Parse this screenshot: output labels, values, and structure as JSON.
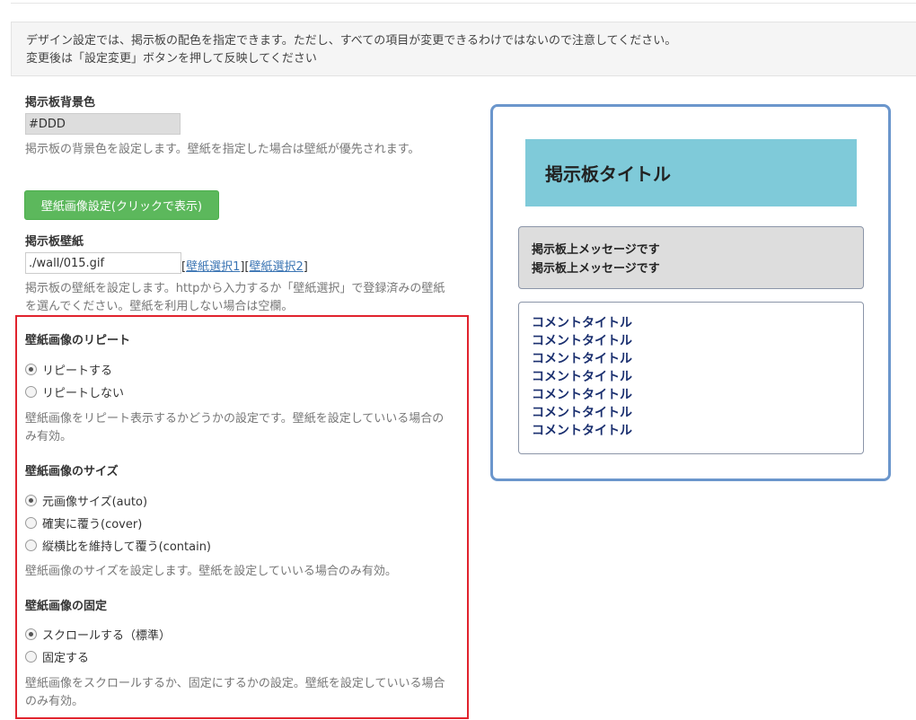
{
  "notice": {
    "line1": "デザイン設定では、掲示板の配色を指定できます。ただし、すべての項目が変更できるわけではないので注意してください。",
    "line2": "変更後は「設定変更」ボタンを押して反映してください"
  },
  "bg_color": {
    "label": "掲示板背景色",
    "value": "#DDD",
    "help": "掲示板の背景色を設定します。壁紙を指定した場合は壁紙が優先されます。"
  },
  "wallpaper_button": {
    "label": "壁紙画像設定(クリックで表示)",
    "color": "#5cb85c"
  },
  "wallpaper": {
    "label": "掲示板壁紙",
    "value": "./wall/015.gif",
    "link1": "壁紙選択1",
    "link2": "壁紙選択2",
    "help": "掲示板の壁紙を設定します。httpから入力するか「壁紙選択」で登録済みの壁紙を選んでください。壁紙を利用しない場合は空欄。"
  },
  "repeat": {
    "title": "壁紙画像のリピート",
    "options": [
      "リピートする",
      "リピートしない"
    ],
    "selected": 0,
    "help": "壁紙画像をリピート表示するかどうかの設定です。壁紙を設定していいる場合のみ有効。"
  },
  "size": {
    "title": "壁紙画像のサイズ",
    "options": [
      "元画像サイズ(auto)",
      "確実に覆う(cover)",
      "縦横比を維持して覆う(contain)"
    ],
    "selected": 0,
    "help": "壁紙画像のサイズを設定します。壁紙を設定していいる場合のみ有効。"
  },
  "fixed": {
    "title": "壁紙画像の固定",
    "options": [
      "スクロールする（標準）",
      "固定する"
    ],
    "selected": 0,
    "help": "壁紙画像をスクロールするか、固定にするかの設定。壁紙を設定していいる場合のみ有効。"
  },
  "preview": {
    "title": "掲示板タイトル",
    "messages": [
      "掲示板上メッセージです",
      "掲示板上メッセージです"
    ],
    "comments": [
      "コメントタイトル",
      "コメントタイトル",
      "コメントタイトル",
      "コメントタイトル",
      "コメントタイトル",
      "コメントタイトル",
      "コメントタイトル"
    ],
    "colors": {
      "frame": "#6b96cc",
      "title_bg": "#7fcad9",
      "message_bg": "#dddddd",
      "wall_bg": "#fdd3b3",
      "highlight": "#e1232d"
    }
  }
}
